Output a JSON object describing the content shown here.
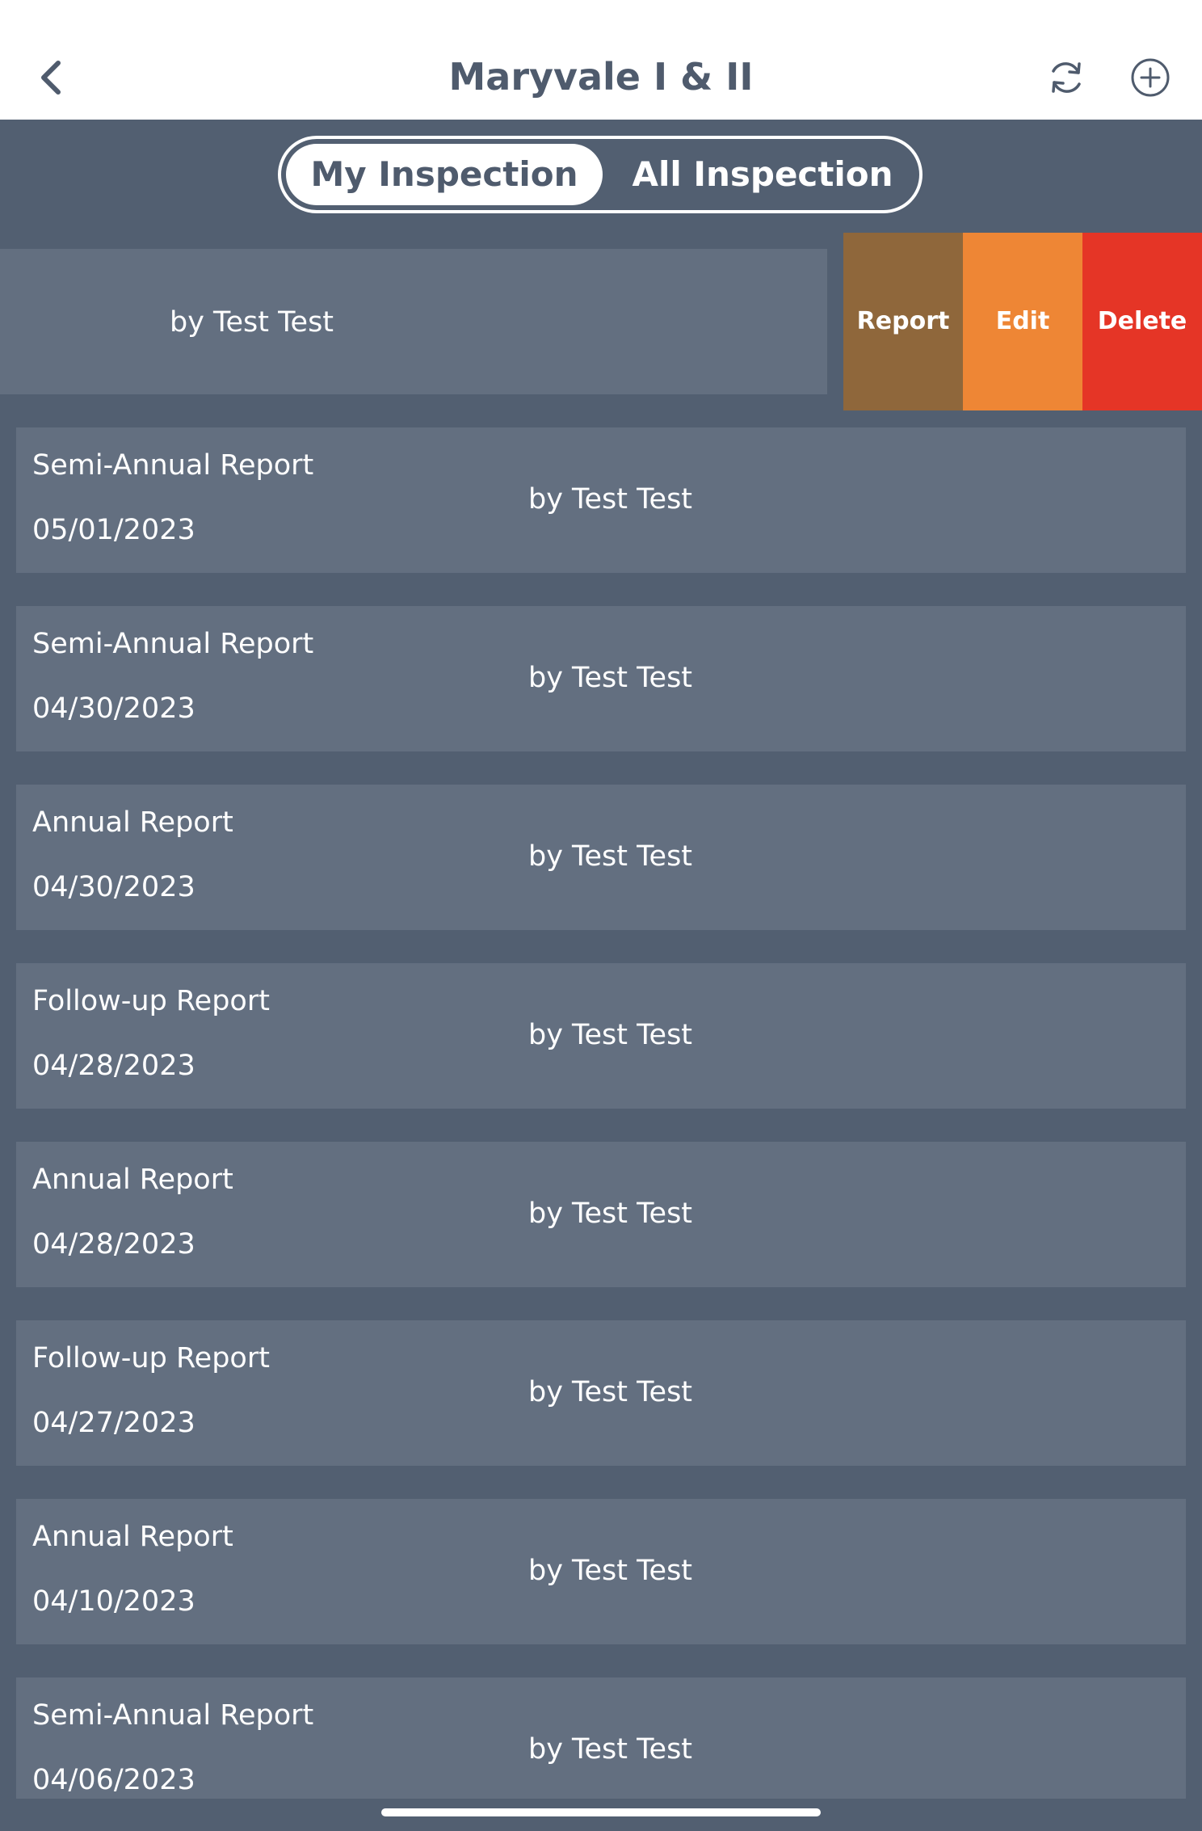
{
  "header": {
    "title": "Maryvale I & II",
    "back_icon": "chevron-left-icon",
    "refresh_icon": "refresh-icon",
    "add_icon": "plus-circle-icon"
  },
  "tabs": [
    {
      "label": "My Inspection",
      "active": true
    },
    {
      "label": "All Inspection",
      "active": false
    }
  ],
  "swiped_row": {
    "author": "by Test Test",
    "actions": [
      {
        "label": "Report",
        "color": "#8f673b"
      },
      {
        "label": "Edit",
        "color": "#ee8635"
      },
      {
        "label": "Delete",
        "color": "#e53526"
      }
    ]
  },
  "rows": [
    {
      "title": "Semi-Annual Report",
      "date": "05/01/2023",
      "author": "by Test Test"
    },
    {
      "title": "Semi-Annual Report",
      "date": "04/30/2023",
      "author": "by Test Test"
    },
    {
      "title": "Annual Report",
      "date": "04/30/2023",
      "author": "by Test Test"
    },
    {
      "title": "Follow-up Report",
      "date": "04/28/2023",
      "author": "by Test Test"
    },
    {
      "title": "Annual Report",
      "date": "04/28/2023",
      "author": "by Test Test"
    },
    {
      "title": "Follow-up Report",
      "date": "04/27/2023",
      "author": "by Test Test"
    },
    {
      "title": "Annual Report",
      "date": "04/10/2023",
      "author": "by Test Test"
    },
    {
      "title": "Semi-Annual Report",
      "date": "04/06/2023",
      "author": "by Test Test"
    }
  ],
  "colors": {
    "header_bg": "#ffffff",
    "page_bg": "#525f71",
    "card_bg": "#636f80",
    "title_text": "#4f5b6d"
  }
}
